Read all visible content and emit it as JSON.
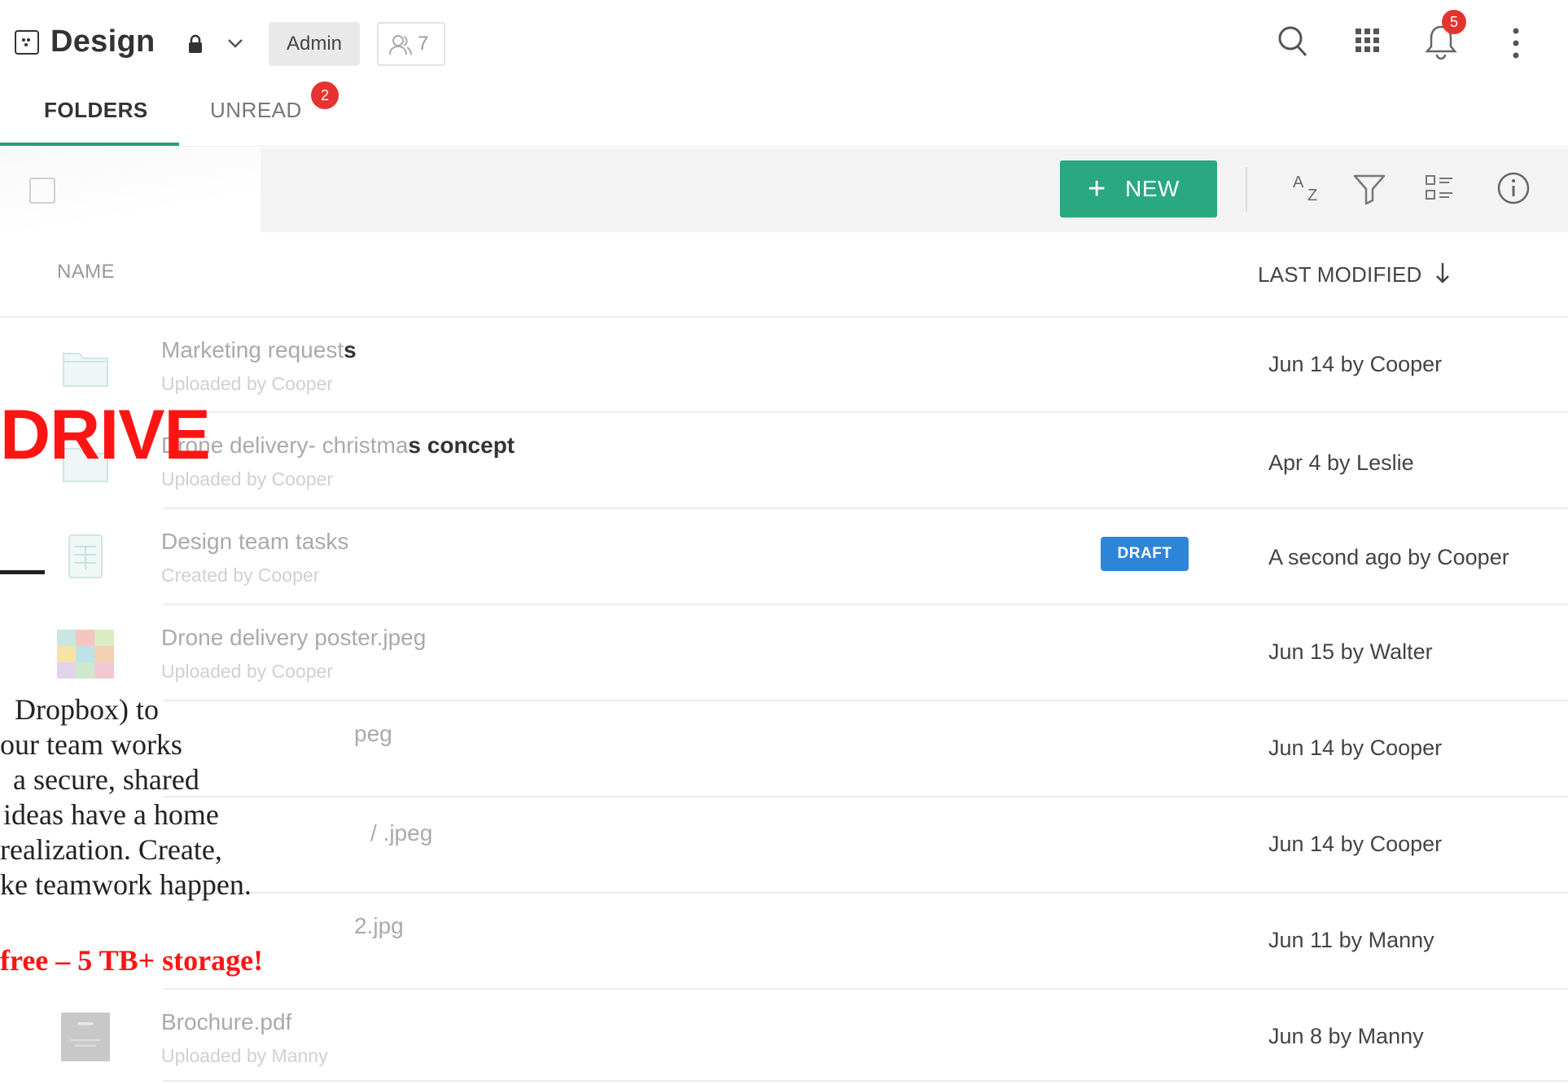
{
  "header": {
    "team_name": "Design",
    "role": "Admin",
    "members_count": "7",
    "notifications_count": "5"
  },
  "tabs": [
    {
      "label": "FOLDERS",
      "active": true
    },
    {
      "label": "UNREAD",
      "badge": "2"
    }
  ],
  "toolbar": {
    "new_label": "NEW"
  },
  "columns": {
    "name": "NAME",
    "last_modified": "LAST MODIFIED"
  },
  "rows": [
    {
      "title_light": "Marketing request",
      "title_dark": "s",
      "subtitle": "Uploaded by Cooper",
      "modified": "Jun 14 by Cooper",
      "icon": "folder-icon"
    },
    {
      "title_light": "Drone delivery- christma",
      "title_dark": "s concept",
      "subtitle": "Uploaded by Cooper",
      "modified": "Apr 4 by Leslie",
      "icon": "folder-icon"
    },
    {
      "title_light": "Design team tasks",
      "title_dark": "",
      "subtitle": "Created by Cooper",
      "modified": "A second ago by Cooper",
      "badge": "DRAFT",
      "icon": "spreadsheet-icon"
    },
    {
      "title_light": "Drone delivery poster.jpeg",
      "title_dark": "",
      "subtitle": "Uploaded by Cooper",
      "modified": "Jun 15 by Walter",
      "icon": "image-thumbnail"
    },
    {
      "title_light": "peg",
      "title_dark": "",
      "subtitle": "",
      "modified": "Jun 14 by Cooper"
    },
    {
      "title_light": "/ .jpeg",
      "title_dark": "",
      "subtitle": "",
      "modified": "Jun 14 by Cooper"
    },
    {
      "title_light": "2.jpg",
      "title_dark": "",
      "subtitle": "",
      "modified": "Jun 11 by Manny"
    },
    {
      "title_light": "Brochure.pdf",
      "title_dark": "",
      "subtitle": "Uploaded by Manny",
      "modified": "Jun 8 by Manny",
      "icon": "pdf-thumbnail"
    }
  ],
  "overlay": {
    "title": "DRIVE",
    "body_lines": [
      "Dropbox) to",
      "our team works",
      "a secure, shared",
      "ideas have a home",
      "realization. Create,",
      "ke teamwork happen."
    ],
    "cta": "free – 5 TB+ storage!"
  },
  "colors": {
    "accent": "#2aa880",
    "badge": "#e5342f",
    "draft": "#2e84d6",
    "promo": "#ff1414"
  }
}
